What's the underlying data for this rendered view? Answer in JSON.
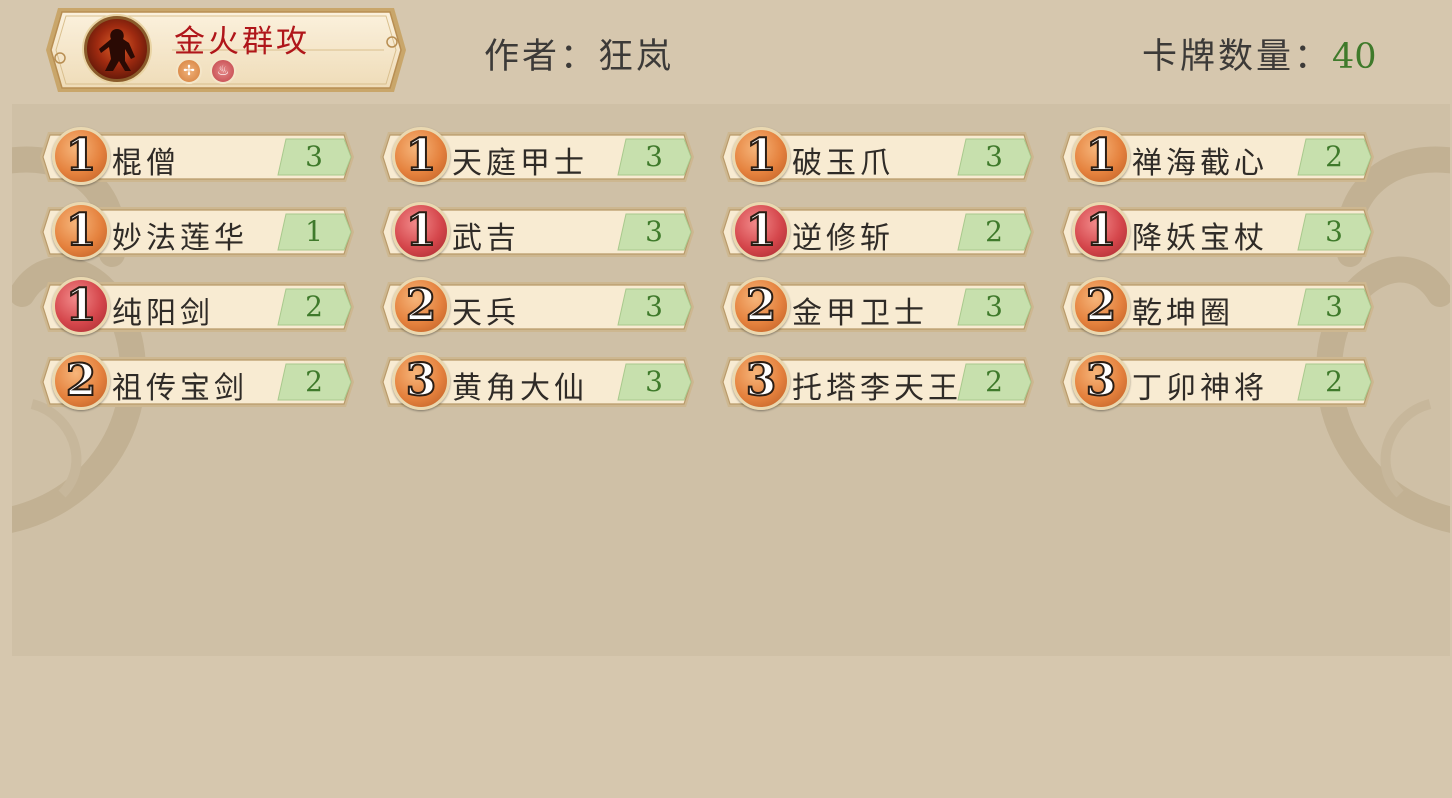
{
  "deck": {
    "name": "金火群攻",
    "element_icons": [
      "metal-element-icon",
      "fire-element-icon"
    ]
  },
  "author_label": "作者：狂岚",
  "card_count": {
    "label": "卡牌数量：",
    "value": "40"
  },
  "colors": {
    "cost_orange": "#e5823e",
    "cost_red": "#d5474c",
    "quantity_green": "#3f7a2b",
    "deck_name_red": "#b0161a"
  },
  "cards": [
    {
      "cost": "1",
      "cost_color": "orange",
      "name": "棍僧",
      "qty": "3"
    },
    {
      "cost": "1",
      "cost_color": "orange",
      "name": "天庭甲士",
      "qty": "3"
    },
    {
      "cost": "1",
      "cost_color": "orange",
      "name": "破玉爪",
      "qty": "3"
    },
    {
      "cost": "1",
      "cost_color": "orange",
      "name": "禅海截心",
      "qty": "2"
    },
    {
      "cost": "1",
      "cost_color": "orange",
      "name": "妙法莲华",
      "qty": "1"
    },
    {
      "cost": "1",
      "cost_color": "red",
      "name": "武吉",
      "qty": "3"
    },
    {
      "cost": "1",
      "cost_color": "red",
      "name": "逆修斩",
      "qty": "2"
    },
    {
      "cost": "1",
      "cost_color": "red",
      "name": "降妖宝杖",
      "qty": "3"
    },
    {
      "cost": "1",
      "cost_color": "red",
      "name": "纯阳剑",
      "qty": "2"
    },
    {
      "cost": "2",
      "cost_color": "orange",
      "name": "天兵",
      "qty": "3"
    },
    {
      "cost": "2",
      "cost_color": "orange",
      "name": "金甲卫士",
      "qty": "3"
    },
    {
      "cost": "2",
      "cost_color": "orange",
      "name": "乾坤圈",
      "qty": "3"
    },
    {
      "cost": "2",
      "cost_color": "orange",
      "name": "祖传宝剑",
      "qty": "2"
    },
    {
      "cost": "3",
      "cost_color": "orange",
      "name": "黄角大仙",
      "qty": "3"
    },
    {
      "cost": "3",
      "cost_color": "orange",
      "name": "托塔李天王",
      "qty": "2"
    },
    {
      "cost": "3",
      "cost_color": "orange",
      "name": "丁卯神将",
      "qty": "2"
    }
  ]
}
